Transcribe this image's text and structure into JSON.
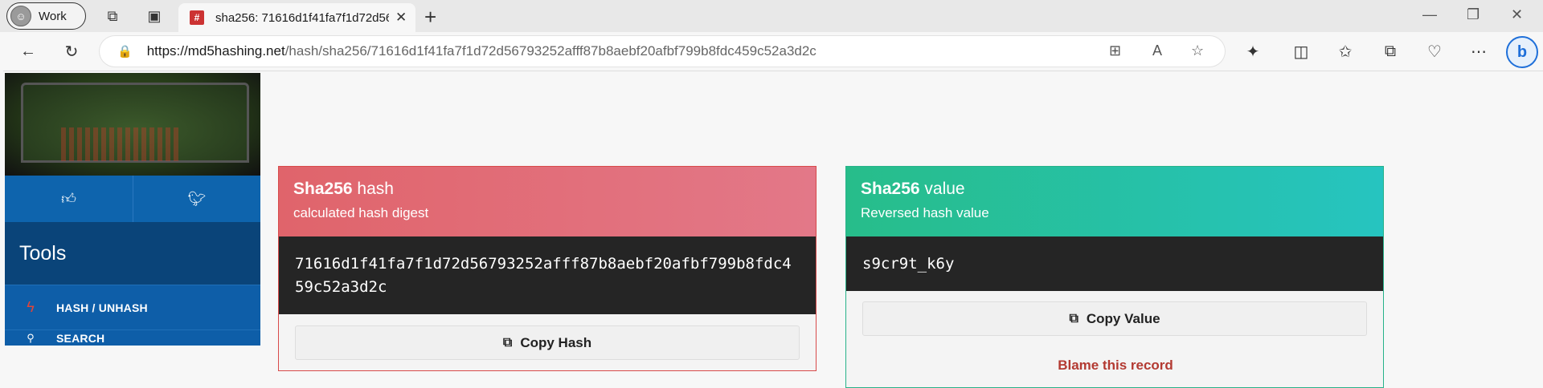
{
  "browser": {
    "profile_label": "Work",
    "tab_title": "sha256: 71616d1f41fa7f1d72d56",
    "favicon_text": "#",
    "url_host": "https://md5hashing.net",
    "url_path": "/hash/sha256/71616d1f41fa7f1d72d56793252afff87b8aebf20afbf799b8fdc459c52a3d2c",
    "bing_label": "b"
  },
  "sidebar": {
    "tools_title": "Tools",
    "menu": [
      {
        "label": "HASH / UNHASH",
        "icon": "bolt-icon"
      },
      {
        "label": "SEARCH",
        "icon": "search-icon"
      }
    ]
  },
  "hash_card": {
    "title_bold": "Sha256",
    "title_rest": " hash",
    "subtitle": "calculated hash digest",
    "hash": "71616d1f41fa7f1d72d56793252afff87b8aebf20afbf799b8fdc459c52a3d2c",
    "copy_label": "Copy Hash"
  },
  "value_card": {
    "title_bold": "Sha256",
    "title_rest": " value",
    "subtitle": "Reversed hash value",
    "value": "s9cr9t_k6y",
    "copy_label": "Copy Value",
    "blame_label": "Blame this record"
  },
  "colors": {
    "hash_header": "#e0646b",
    "value_header": "#27bd8a",
    "sidebar_blue": "#115a9e",
    "blame_red": "#b33a32"
  }
}
